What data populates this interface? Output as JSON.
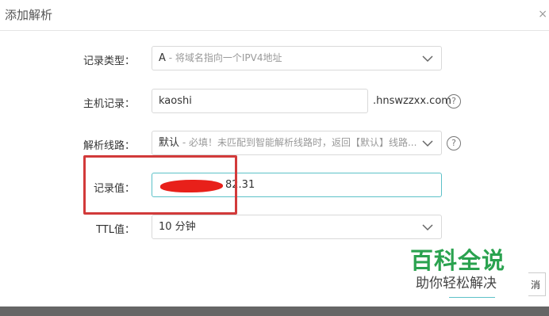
{
  "dialog": {
    "title": "添加解析",
    "close_glyph": "×"
  },
  "form": {
    "record_type": {
      "label": "记录类型：",
      "value": "A",
      "hint": " - 将域名指向一个IPV4地址"
    },
    "host": {
      "label": "主机记录：",
      "value": "kaoshi",
      "suffix": ".hnswzzxx.com",
      "help": "?"
    },
    "line": {
      "label": "解析线路：",
      "value": "默认",
      "hint": " - 必填！未匹配到智能解析线路时，返回【默认】线路...",
      "help": "?"
    },
    "record_value": {
      "label": "记录值：",
      "value": "82.31"
    },
    "ttl": {
      "label": "TTL值：",
      "value": "10 分钟"
    }
  },
  "buttons": {
    "cancel_partial": "消"
  },
  "watermark": {
    "main": "百科全说",
    "sub": "助你轻松解决"
  },
  "colors": {
    "accent": "#5cc1c8",
    "highlight_box": "#d23a3a",
    "watermark_green": "#2aa24f"
  }
}
